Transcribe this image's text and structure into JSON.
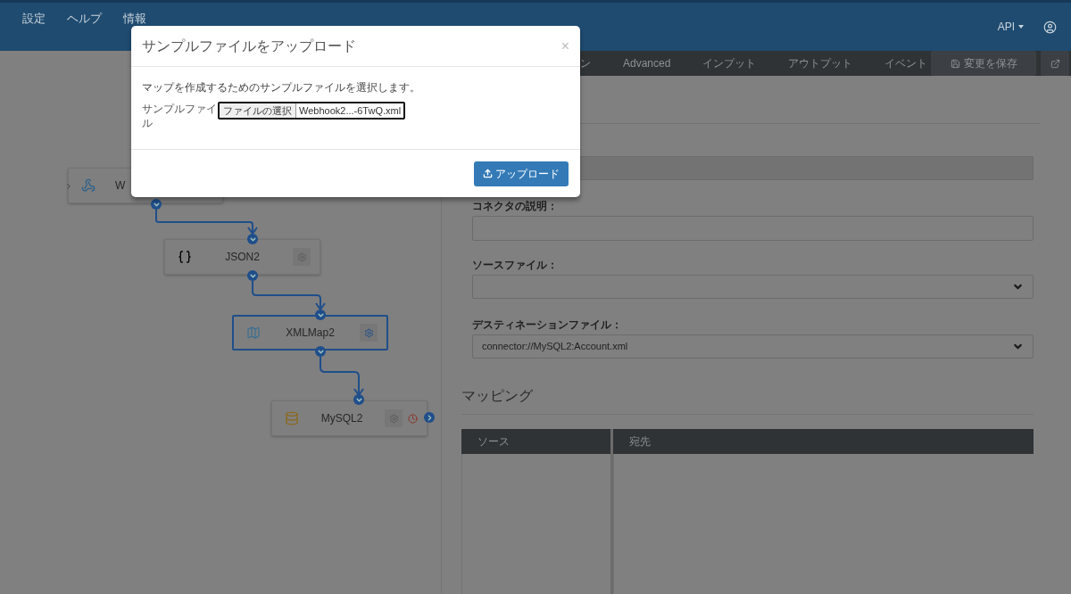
{
  "top_nav": {
    "items": [
      "設定",
      "ヘルプ",
      "情報"
    ],
    "api_menu": "API"
  },
  "tabs": [
    {
      "label": "ン",
      "selected": false
    },
    {
      "label": "Advanced",
      "selected": false
    },
    {
      "label": "インプット",
      "selected": false
    },
    {
      "label": "アウトプット",
      "selected": false
    },
    {
      "label": "イベント",
      "selected": false
    }
  ],
  "save_button": "変更を保存",
  "form": {
    "description_label": "コネクタの説明：",
    "source_label": "ソースファイル：",
    "destination_label": "デスティネーションファイル：",
    "destination_value": "connector://MySQL2:Account.xml"
  },
  "mapping": {
    "title": "マッピング",
    "columns": [
      "ソース",
      "宛先"
    ]
  },
  "flow": {
    "nodes": [
      {
        "name": "W",
        "kind": "webhook",
        "selected": false
      },
      {
        "name": "JSON2",
        "kind": "json",
        "selected": false
      },
      {
        "name": "XMLMap2",
        "kind": "xmlmap",
        "selected": true
      },
      {
        "name": "MySQL2",
        "kind": "mysql",
        "selected": false
      }
    ]
  },
  "dialog": {
    "title": "サンプルファイルをアップロード",
    "close": "×",
    "message": "マップを作成するためのサンプルファイルを選択します。",
    "file_label": "サンプルファイル",
    "choose_button": "ファイルの選択",
    "file_name": "Webhook2...-6TwQ.xml",
    "upload_button": "アップロード"
  }
}
